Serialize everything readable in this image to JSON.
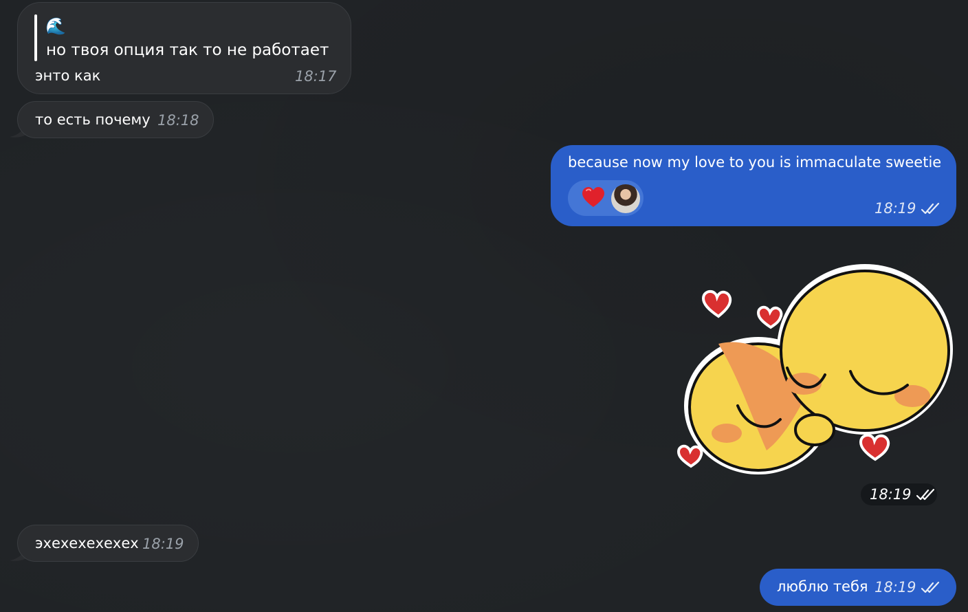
{
  "messages": [
    {
      "id": "m1",
      "direction": "incoming",
      "quote": {
        "emoji": "🌊",
        "text": "но твоя опция так то не работает"
      },
      "text": "энто как",
      "time": "18:17"
    },
    {
      "id": "m2",
      "direction": "incoming",
      "text": "то есть почему",
      "time": "18:18"
    },
    {
      "id": "m3",
      "direction": "outgoing",
      "text": "because now my love to you is immaculate sweetie",
      "time": "18:19",
      "reaction": {
        "emoji": "heart-icon"
      },
      "status": "read"
    },
    {
      "id": "m4",
      "direction": "outgoing",
      "type": "sticker",
      "sticker_name": "hugging-emoji-sticker",
      "time": "18:19",
      "status": "read"
    },
    {
      "id": "m5",
      "direction": "incoming",
      "text": "эхехехехехех",
      "time": "18:19"
    },
    {
      "id": "m6",
      "direction": "outgoing",
      "text": "люблю тебя",
      "time": "18:19",
      "status": "read"
    }
  ],
  "colors": {
    "background": "#202326",
    "incoming_bubble": "#2b2d30",
    "outgoing_bubble": "#2a5ec9",
    "timestamp_incoming": "#9aa1a9",
    "heart": "#e0212b"
  }
}
